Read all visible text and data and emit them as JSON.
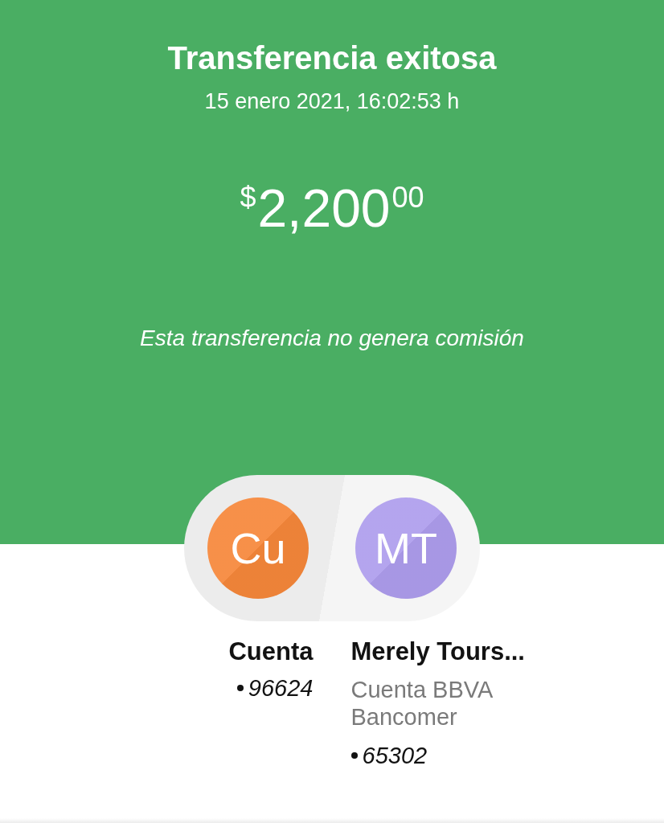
{
  "title": "Transferencia exitosa",
  "datetime": "15 enero 2021, 16:02:53 h",
  "amount": {
    "currency": "$",
    "integer": "2,200",
    "cents": "00"
  },
  "note": "Esta transferencia no genera comisión",
  "parties": [
    {
      "initials": "Cu",
      "color": "#f6873a",
      "name": "Cuenta",
      "account": "96624"
    },
    {
      "initials": "MT",
      "color": "#ae9ded",
      "name": "Merely Tours...",
      "lines": [
        "Cuenta BBVA",
        "Bancomer"
      ],
      "account": "65302"
    }
  ]
}
